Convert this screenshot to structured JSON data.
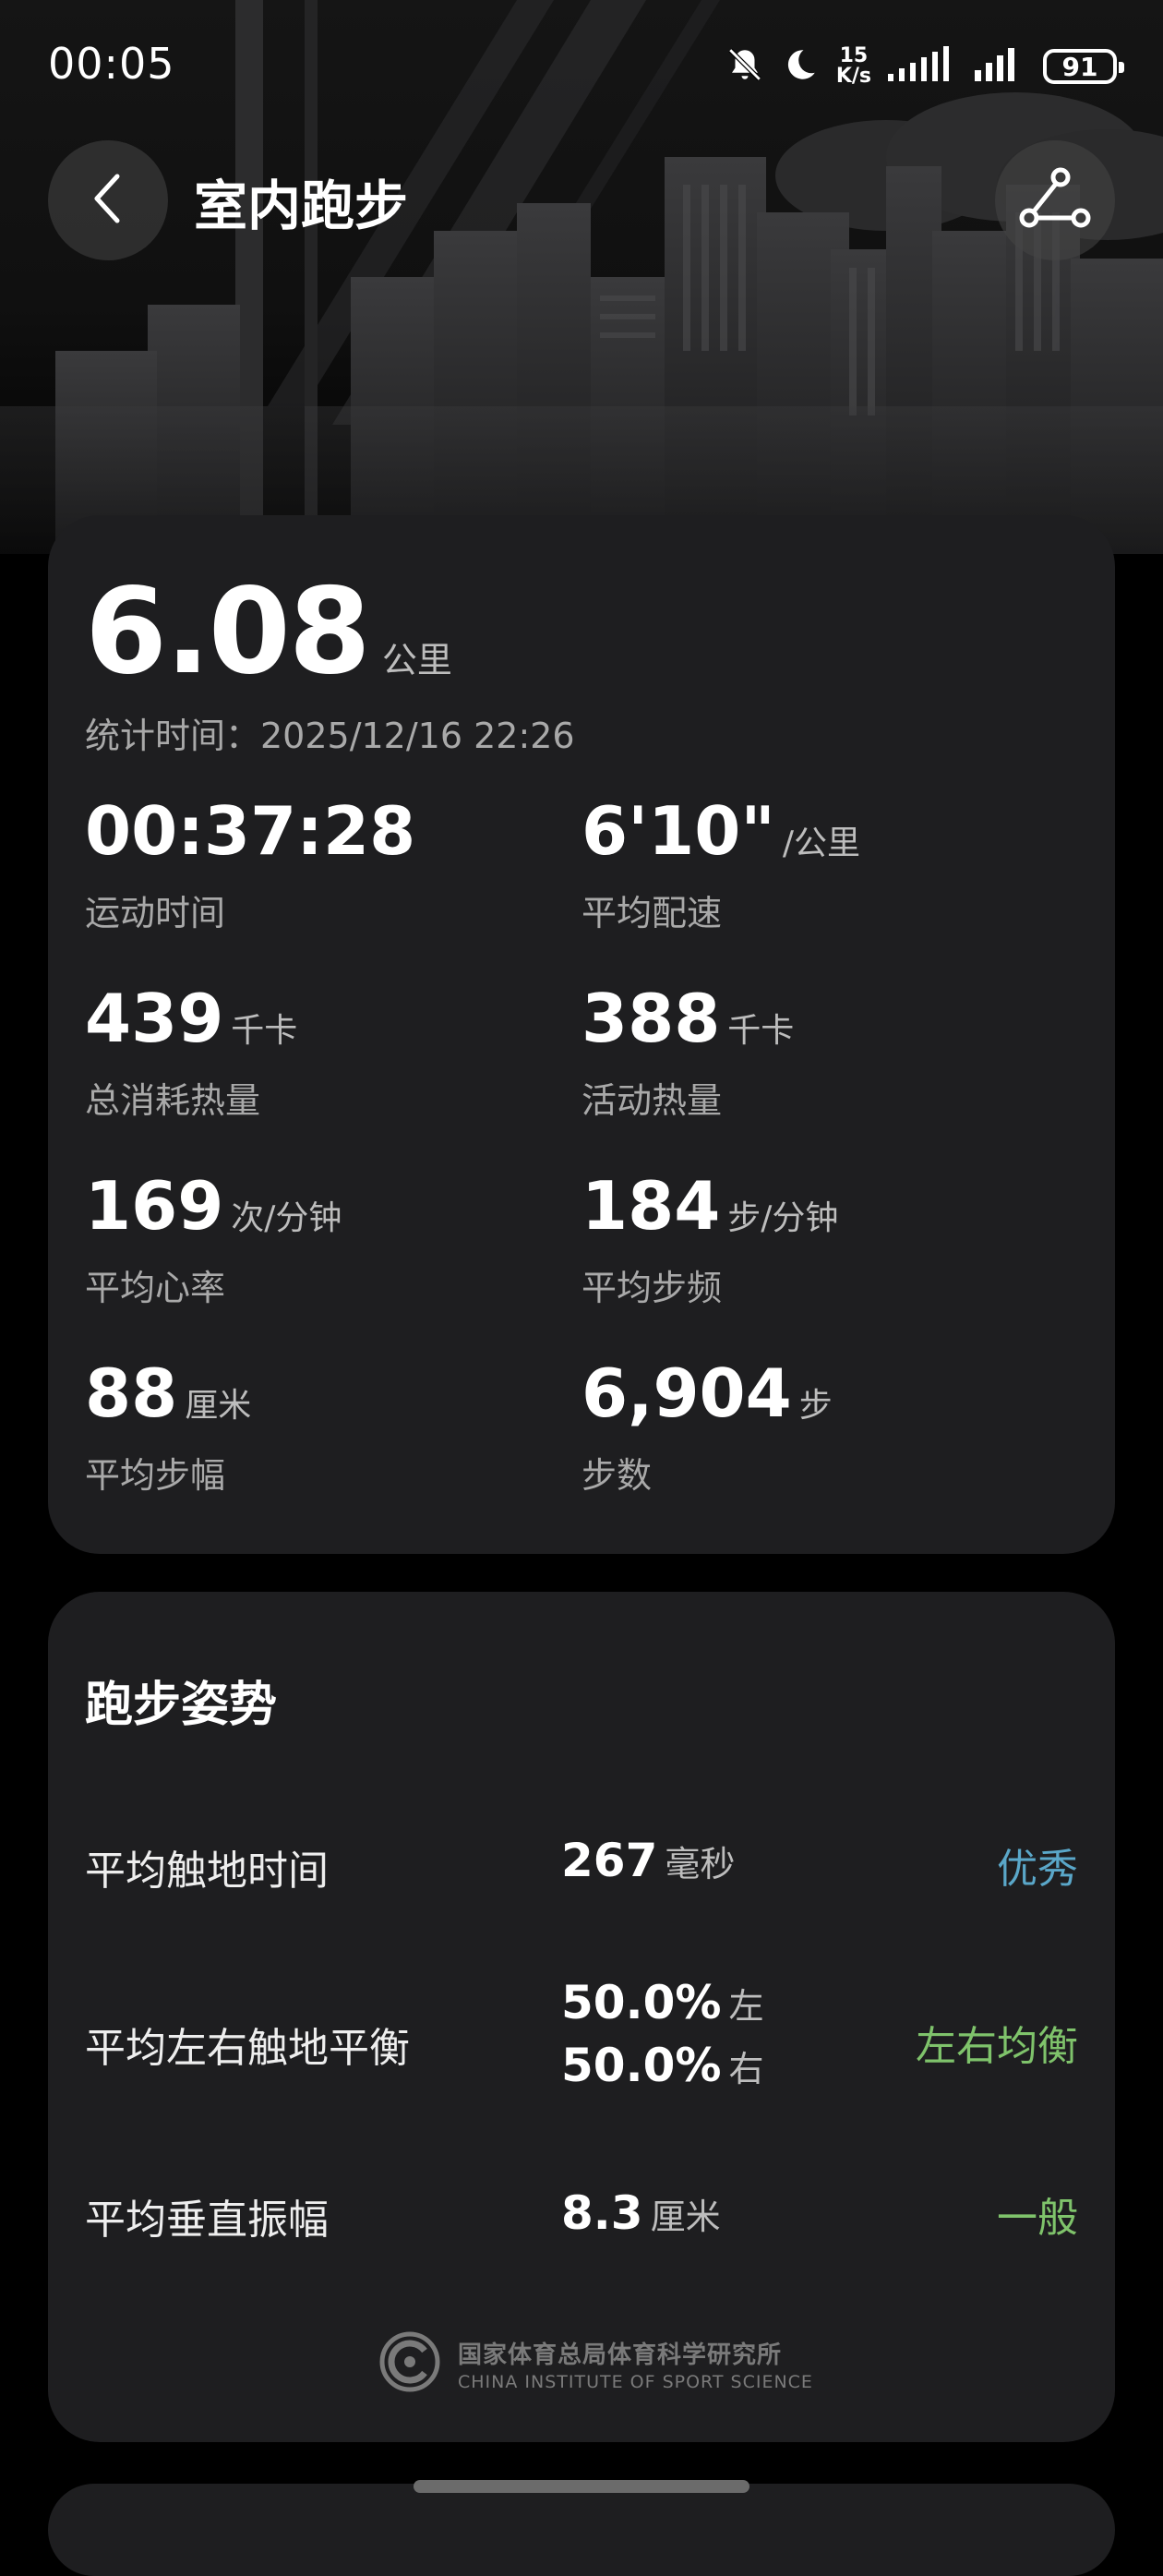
{
  "status_bar": {
    "time": "00:05",
    "net_speed_value": "15",
    "net_speed_unit": "K/s",
    "battery": "91"
  },
  "header": {
    "title": "室内跑步",
    "back_icon": "chevron-left-icon",
    "share_icon": "share-icon"
  },
  "summary": {
    "distance": "6.08",
    "distance_unit": "公里",
    "stat_time": "统计时间：2025/12/16 22:26",
    "metrics": [
      {
        "value": "00:37:28",
        "unit": "",
        "label": "运动时间"
      },
      {
        "value": "6'10\"",
        "unit": "/公里",
        "label": "平均配速"
      },
      {
        "value": "439",
        "unit": "千卡",
        "label": "总消耗热量"
      },
      {
        "value": "388",
        "unit": "千卡",
        "label": "活动热量"
      },
      {
        "value": "169",
        "unit": "次/分钟",
        "label": "平均心率"
      },
      {
        "value": "184",
        "unit": "步/分钟",
        "label": "平均步频"
      },
      {
        "value": "88",
        "unit": "厘米",
        "label": "平均步幅"
      },
      {
        "value": "6,904",
        "unit": "步",
        "label": "步数"
      }
    ]
  },
  "running_form": {
    "title": "跑步姿势",
    "rows": [
      {
        "label": "平均触地时间",
        "value": "267",
        "unit": "毫秒",
        "rating": "优秀",
        "rating_color": "#5aa7c9"
      },
      {
        "label": "平均左右触地平衡",
        "value": "50.0%",
        "unit": "左",
        "value2": "50.0%",
        "unit2": "右",
        "rating": "左右均衡",
        "rating_color": "#7fc36b"
      },
      {
        "label": "平均垂直振幅",
        "value": "8.3",
        "unit": "厘米",
        "rating": "一般",
        "rating_color": "#7fc36b"
      }
    ],
    "institute_cn": "国家体育总局体育科学研究所",
    "institute_en": "CHINA INSTITUTE OF SPORT SCIENCE"
  }
}
